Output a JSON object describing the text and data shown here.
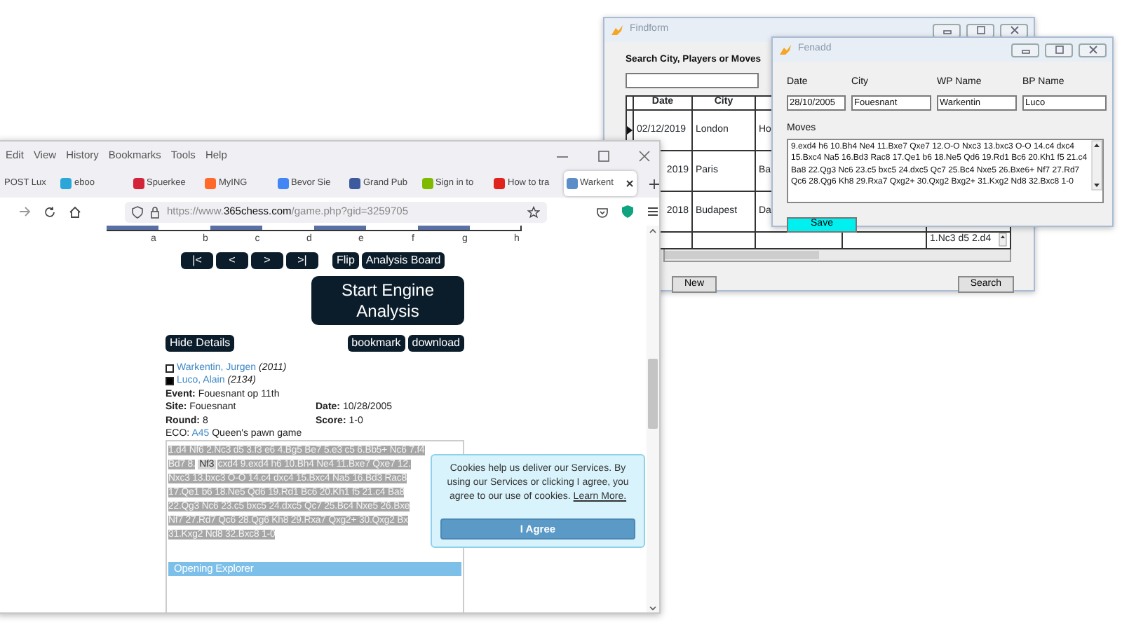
{
  "findform": {
    "title": "Findform",
    "search_label": "Search City, Players or Moves",
    "columns": [
      "Date",
      "City"
    ],
    "rows": [
      {
        "selected": true,
        "date": "02/12/2019",
        "city": "London",
        "column_3": "Ho"
      },
      {
        "date": "2019",
        "city": "Paris",
        "column_3": "Ba"
      },
      {
        "date": "2018",
        "city": "Budapest",
        "column_3": "Da"
      },
      {
        "moves": "1.Nc3 d5 2.d4"
      }
    ],
    "buttons": [
      "New",
      "Search"
    ]
  },
  "fenadd": {
    "title": "Fenadd",
    "fields": [
      {
        "label": "Date",
        "value": "28/10/2005"
      },
      {
        "label": "City",
        "value": "Fouesnant"
      },
      {
        "label": "WP Name",
        "value": "Warkentin"
      },
      {
        "label": "BP Name",
        "value": "Luco"
      }
    ],
    "moves_label": "Moves",
    "moves": "9.exd4 h6 10.Bh4 Ne4 11.Bxe7 Qxe7 12.O-O Nxc3 13.bxc3 O-O 14.c4 dxc4 15.Bxc4 Na5 16.Bd3 Rac8 17.Qe1 b6 18.Ne5 Qd6 19.Rd1 Bc6 20.Kh1 f5 21.c4 Ba8 22.Qg3 Nc6 23.c5 bxc5 24.dxc5 Qc7 25.Bc4 Nxe5 26.Bxe6+ Nf7 27.Rd7 Qc6 28.Qg6 Kh8 29.Rxa7 Qxg2+ 30.Qxg2 Bxg2+ 31.Kxg2 Nd8 32.Bxc8 1-0",
    "save_button": "Save"
  },
  "browser": {
    "menu": [
      "Edit",
      "View",
      "History",
      "Bookmarks",
      "Tools",
      "Help"
    ],
    "tabs": [
      {
        "label": "POST Lux",
        "selected": false
      },
      {
        "label": "eboo",
        "selected": false,
        "color": "#2aa6d9"
      },
      {
        "label": "Spuerkee",
        "selected": false,
        "color": "#d4243a"
      },
      {
        "label": "MyING",
        "selected": false,
        "color": "#ff6a2b"
      },
      {
        "label": "Bevor Sie",
        "selected": false,
        "color": "#4285f4"
      },
      {
        "label": "Grand Pub",
        "selected": false,
        "color": "#3d5a9e"
      },
      {
        "label": "Sign in to",
        "selected": false,
        "color": "#7fba00"
      },
      {
        "label": "How to tra",
        "selected": false,
        "color": "#e0241b"
      },
      {
        "label": "Warkent",
        "selected": true,
        "color": "#5b8ec9"
      }
    ],
    "url": {
      "prefix": "https://www.",
      "domain": "365chess.com",
      "path": "/game.php?gid=3259705"
    },
    "page": {
      "files": [
        "a",
        "b",
        "c",
        "d",
        "e",
        "f",
        "g",
        "h"
      ],
      "nav_buttons": [
        "|<",
        "<",
        ">",
        ">|",
        "Flip",
        "Analysis Board"
      ],
      "engine_button": "Start Engine Analysis",
      "details_button": "Hide Details",
      "action_buttons": [
        "bookmark",
        "download"
      ],
      "players": [
        {
          "filled": false,
          "name": "Warkentin, Jurgen",
          "rating": "(2011)"
        },
        {
          "filled": true,
          "name": "Luco, Alain",
          "rating": "(2134)"
        }
      ],
      "event": "**Event:** Fouesnant op 11th",
      "info_pairs": [
        [
          "**Site:** Fouesnant",
          "**Date:** 10/28/2005"
        ],
        [
          "**Round:** 8",
          "**Score:** 1-0"
        ]
      ],
      "eco": {
        "label": "ECO:",
        "code": "A45",
        "name": "Queen's pawn game"
      },
      "move_lines": [
        [
          {
            "text": "1.d4 Nf6 2.Nc3 d5 3.f3 e6 4.Bg5 Be7 5.e3 c5 6.Bb5+ Nc6 7.f4",
            "current": false
          }
        ],
        [
          {
            "text": "Bd7 8.",
            "current": false
          },
          {
            "text": "Nf3",
            "current": true
          },
          {
            "text": "cxd4 9.exd4 h6 10.Bh4 Ne4 11.Bxe7 Qxe7 12.",
            "current": false
          }
        ],
        [
          {
            "text": "Nxc3 13.bxc3 O-O 14.c4 dxc4 15.Bxc4 Na5 16.Bd3 Rac8",
            "current": false
          }
        ],
        [
          {
            "text": "17.Qe1 b6 18.Ne5 Qd6 19.Rd1 Bc6 20.Kh1 f5 21.c4 Ba8",
            "current": false
          }
        ],
        [
          {
            "text": "22.Qg3 Nc6 23.c5 bxc5 24.dxc5 Qc7 25.Bc4 Nxe5 26.Bxe",
            "current": false
          }
        ],
        [
          {
            "text": "Nf7 27.Rd7 Qc6 28.Qg6 Kh8 29.Rxa7 Qxg2+ 30.Qxg2 Bx",
            "current": false
          }
        ],
        [
          {
            "text": "31.Kxg2 Nd8 32.Bxc8 1-0",
            "current": false
          }
        ]
      ],
      "opening_explorer": "Opening Explorer"
    },
    "cookie_banner": {
      "text": "Cookies help us deliver our Services. By using our Services or clicking I agree, you agree to our use of cookies.",
      "link": "Learn More.",
      "button": "I Agree"
    }
  }
}
